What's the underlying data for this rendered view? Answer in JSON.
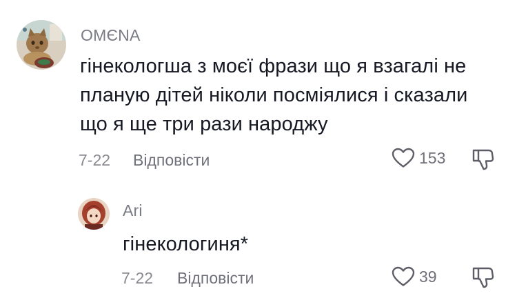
{
  "comment": {
    "username": "ОМЄNA",
    "text_lines": [
      "гінекологша з моєї фрази що я взагалі не",
      "планую дітей ніколи посміялися і сказали",
      "що я ще три рази народжу"
    ],
    "date": "7-22",
    "reply_label": "Відповісти",
    "likes": "153",
    "avatar_icon": "cat-avatar-icon",
    "like_icon": "heart-outline-icon",
    "dislike_icon": "thumb-down-icon"
  },
  "reply": {
    "username": "Ari",
    "text": "гінекологиня*",
    "date": "7-22",
    "reply_label": "Відповісти",
    "likes": "39",
    "avatar_icon": "anime-girl-avatar-icon"
  },
  "colors": {
    "text": "#161823",
    "muted": "#8a8b91",
    "username": "#7a7b85"
  }
}
